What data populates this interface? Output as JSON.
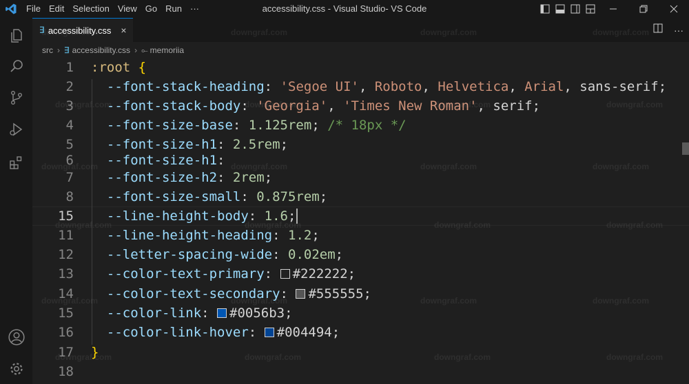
{
  "app": {
    "window_title": "accessibility.css - Visual Studio- VS Code",
    "accent": "#0078d4"
  },
  "menu": [
    "File",
    "Edit",
    "Selection",
    "View",
    "Go",
    "Run",
    "···"
  ],
  "activity_icons": [
    "explorer-icon",
    "search-icon",
    "source-control-icon",
    "run-debug-icon",
    "extensions-icon",
    "account-icon",
    "settings-gear-icon"
  ],
  "tab": {
    "label": "accessibility.css",
    "close": "×",
    "icon": "css-file-icon"
  },
  "breadcrumb": [
    "src",
    "accessibility.css",
    "memoriia"
  ],
  "watermark": "downgraf.com",
  "editor": {
    "active_line_number": "15",
    "lines": [
      {
        "n": "1",
        "segs": [
          {
            "t": ":root ",
            "c": "sel"
          },
          {
            "t": "{",
            "c": "br"
          }
        ]
      },
      {
        "n": "2",
        "segs": [
          {
            "t": "  --font-stack-heading",
            "c": "p"
          },
          {
            "t": ": ",
            "c": "plain"
          },
          {
            "t": "'Segoe UI'",
            "c": "s"
          },
          {
            "t": ", ",
            "c": "plain"
          },
          {
            "t": "Roboto",
            "c": "s"
          },
          {
            "t": ", ",
            "c": "plain"
          },
          {
            "t": "Helvetica",
            "c": "s"
          },
          {
            "t": ", ",
            "c": "plain"
          },
          {
            "t": "Arial",
            "c": "s"
          },
          {
            "t": ", sans-serif;",
            "c": "plain"
          }
        ]
      },
      {
        "n": "3",
        "segs": [
          {
            "t": "  --font-stack-body",
            "c": "p"
          },
          {
            "t": ": ",
            "c": "plain"
          },
          {
            "t": "'Georgia'",
            "c": "s"
          },
          {
            "t": ", ",
            "c": "plain"
          },
          {
            "t": "'Times New Roman'",
            "c": "s"
          },
          {
            "t": ", serif;",
            "c": "plain"
          }
        ]
      },
      {
        "n": "4",
        "segs": [
          {
            "t": "  --font-size-base",
            "c": "p"
          },
          {
            "t": ": ",
            "c": "plain"
          },
          {
            "t": "1.125rem",
            "c": "n"
          },
          {
            "t": "; ",
            "c": "plain"
          },
          {
            "t": "/* 18px */",
            "c": "c"
          }
        ]
      },
      {
        "n": "5",
        "segs": [
          {
            "t": "  --font-size-h1",
            "c": "p"
          },
          {
            "t": ": ",
            "c": "plain"
          },
          {
            "t": "2.5rem",
            "c": "n"
          },
          {
            "t": ";",
            "c": "plain"
          }
        ]
      },
      {
        "n": "6",
        "segs": [
          {
            "t": "  --font-size-h1",
            "c": "p"
          },
          {
            "t": ":",
            "c": "plain"
          }
        ]
      },
      {
        "n": "7",
        "segs": [
          {
            "t": "  --font-size-h2",
            "c": "p"
          },
          {
            "t": ": ",
            "c": "plain"
          },
          {
            "t": "2rem",
            "c": "n"
          },
          {
            "t": ";",
            "c": "plain"
          }
        ]
      },
      {
        "n": "8",
        "segs": [
          {
            "t": "  --font-size-small",
            "c": "p"
          },
          {
            "t": ": ",
            "c": "plain"
          },
          {
            "t": "0.875rem",
            "c": "n"
          },
          {
            "t": ";",
            "c": "plain"
          }
        ]
      },
      {
        "n": "15",
        "segs": [
          {
            "t": "  --line-height-body",
            "c": "p"
          },
          {
            "t": ": ",
            "c": "plain"
          },
          {
            "t": "1.6",
            "c": "n"
          },
          {
            "t": ";",
            "c": "plain"
          }
        ]
      },
      {
        "n": "11",
        "segs": [
          {
            "t": "  --line-height-heading",
            "c": "p"
          },
          {
            "t": ": ",
            "c": "plain"
          },
          {
            "t": "1.2",
            "c": "n"
          },
          {
            "t": ";",
            "c": "plain"
          }
        ]
      },
      {
        "n": "12",
        "segs": [
          {
            "t": "  --letter-spacing-wide",
            "c": "p"
          },
          {
            "t": ": ",
            "c": "plain"
          },
          {
            "t": "0.02em",
            "c": "n"
          },
          {
            "t": ";",
            "c": "plain"
          }
        ]
      },
      {
        "n": "13",
        "segs": [
          {
            "t": "  --color-text-primary",
            "c": "p"
          },
          {
            "t": ": ",
            "c": "plain"
          },
          {
            "sw": "#222222"
          },
          {
            "t": "#222222",
            "c": "plain"
          },
          {
            "t": ";",
            "c": "plain"
          }
        ]
      },
      {
        "n": "14",
        "segs": [
          {
            "t": "  --color-text-secondary",
            "c": "p"
          },
          {
            "t": ": ",
            "c": "plain"
          },
          {
            "sw": "#555555"
          },
          {
            "t": "#555555",
            "c": "plain"
          },
          {
            "t": ";",
            "c": "plain"
          }
        ]
      },
      {
        "n": "15",
        "segs": [
          {
            "t": "  --color-link",
            "c": "p"
          },
          {
            "t": ": ",
            "c": "plain"
          },
          {
            "sw": "#0056b3"
          },
          {
            "t": "#0056b3",
            "c": "plain"
          },
          {
            "t": ";",
            "c": "plain"
          }
        ]
      },
      {
        "n": "16",
        "segs": [
          {
            "t": "  --color-link-hover",
            "c": "p"
          },
          {
            "t": ": ",
            "c": "plain"
          },
          {
            "sw": "#004494"
          },
          {
            "t": "#004494",
            "c": "plain"
          },
          {
            "t": ";",
            "c": "plain"
          }
        ]
      },
      {
        "n": "17",
        "segs": [
          {
            "t": "}",
            "c": "br"
          }
        ]
      },
      {
        "n": "18",
        "segs": []
      }
    ]
  }
}
